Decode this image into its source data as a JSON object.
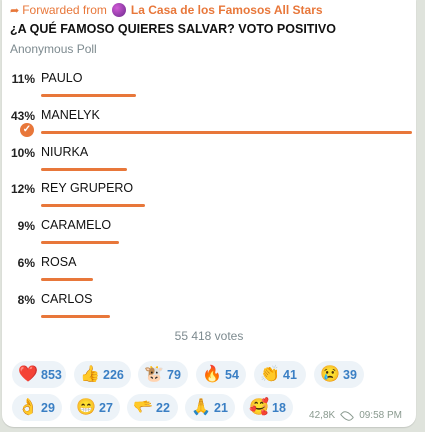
{
  "forward": {
    "prefix": "Forwarded from",
    "channel": "La Casa de los Famosos All Stars"
  },
  "poll": {
    "question": "¿A QUÉ FAMOSO QUIERES SALVAR? VOTO POSITIVO",
    "type": "Anonymous Poll",
    "options": [
      {
        "percent": "11%",
        "label": "PAULO",
        "fraction": 0.11
      },
      {
        "percent": "43%",
        "label": "MANELYK",
        "fraction": 0.43,
        "selected": true
      },
      {
        "percent": "10%",
        "label": "NIURKA",
        "fraction": 0.1
      },
      {
        "percent": "12%",
        "label": "REY GRUPERO",
        "fraction": 0.12
      },
      {
        "percent": "9%",
        "label": "CARAMELO",
        "fraction": 0.09
      },
      {
        "percent": "6%",
        "label": "ROSA",
        "fraction": 0.06
      },
      {
        "percent": "8%",
        "label": "CARLOS",
        "fraction": 0.08
      }
    ],
    "votes": "55 418 votes"
  },
  "reactions": [
    {
      "icon": "heart-icon",
      "glyph": "❤️",
      "count": "853"
    },
    {
      "icon": "thumbs-up-icon",
      "glyph": "👍",
      "count": "226"
    },
    {
      "icon": "bull-face-icon",
      "glyph": "🐮",
      "count": "79"
    },
    {
      "icon": "fire-icon",
      "glyph": "🔥",
      "count": "54"
    },
    {
      "icon": "clapping-hands-icon",
      "glyph": "👏",
      "count": "41"
    },
    {
      "icon": "crying-face-icon",
      "glyph": "😢",
      "count": "39"
    },
    {
      "icon": "ok-hand-icon",
      "glyph": "👌",
      "count": "29"
    },
    {
      "icon": "grinning-face-icon",
      "glyph": "😁",
      "count": "27"
    },
    {
      "icon": "pointing-hand-icon",
      "glyph": "🫳",
      "count": "22"
    },
    {
      "icon": "praying-hands-icon",
      "glyph": "🙏",
      "count": "21"
    },
    {
      "icon": "smiling-hearts-icon",
      "glyph": "🥰",
      "count": "18"
    }
  ],
  "meta": {
    "views": "42,8K",
    "time": "09:58 PM"
  },
  "colors": {
    "accent": "#e8773a",
    "reaction_text": "#3a7fc4",
    "reaction_bg": "#edf3f8"
  }
}
